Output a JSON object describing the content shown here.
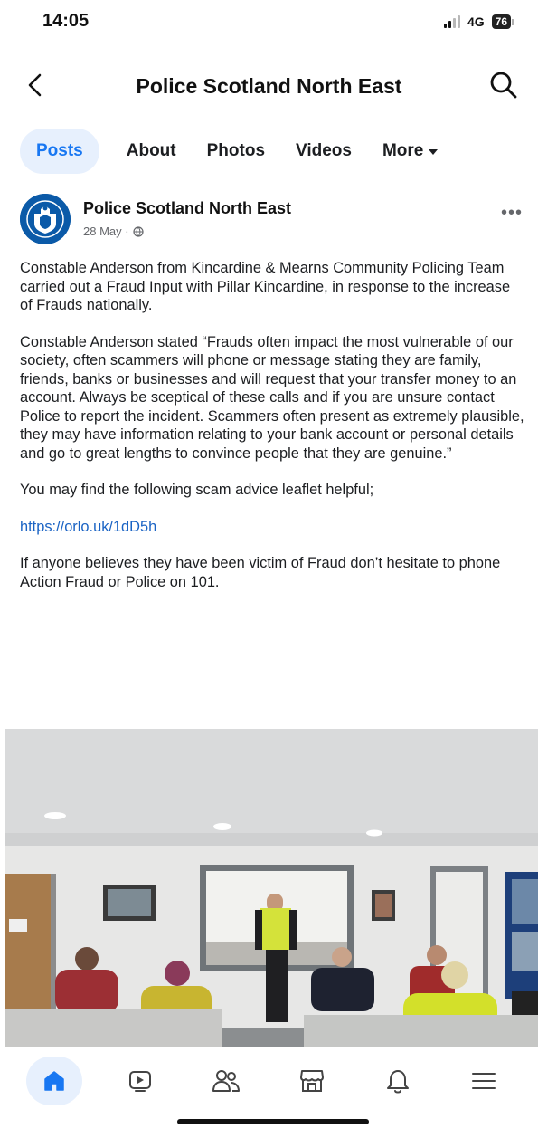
{
  "status_bar": {
    "time": "14:05",
    "network": "4G",
    "battery": "76"
  },
  "header": {
    "title": "Police Scotland North East",
    "back_icon": "chevron-left-icon",
    "search_icon": "search-icon"
  },
  "tabs": [
    {
      "label": "Posts",
      "active": true
    },
    {
      "label": "About",
      "active": false
    },
    {
      "label": "Photos",
      "active": false
    },
    {
      "label": "Videos",
      "active": false
    },
    {
      "label": "More",
      "active": false
    }
  ],
  "post": {
    "author": "Police Scotland North East",
    "date": "28 May ·",
    "more_label": "•••",
    "paragraphs": [
      "Constable Anderson from Kincardine & Mearns Community Policing Team carried out a Fraud Input with Pillar Kincardine, in response to the increase of Frauds nationally.",
      "Constable Anderson stated “Frauds often impact the most vulnerable of our society, often scammers will phone or message stating they are family, friends, banks or businesses and will request that your transfer money to an account.  Always be sceptical of these calls and if you are unsure contact Police to report the incident.  Scammers often present as extremely plausible, they may have information relating to your bank account or personal details and go to great lengths to convince people that they are genuine.”",
      "You may find the following scam advice leaflet helpful;"
    ],
    "link": "https://orlo.uk/1dD5h",
    "closing": "If anyone believes they have been victim of Fraud don’t hesitate to phone Action Fraud or Police on 101."
  },
  "bottom_nav": [
    {
      "icon": "home-icon",
      "active": true
    },
    {
      "icon": "video-icon",
      "active": false
    },
    {
      "icon": "friends-icon",
      "active": false
    },
    {
      "icon": "marketplace-icon",
      "active": false
    },
    {
      "icon": "bell-icon",
      "active": false
    },
    {
      "icon": "menu-icon",
      "active": false
    }
  ],
  "colors": {
    "accent": "#1877f2",
    "tab_active_bg": "#e7f0fd",
    "link": "#1a63c4"
  }
}
